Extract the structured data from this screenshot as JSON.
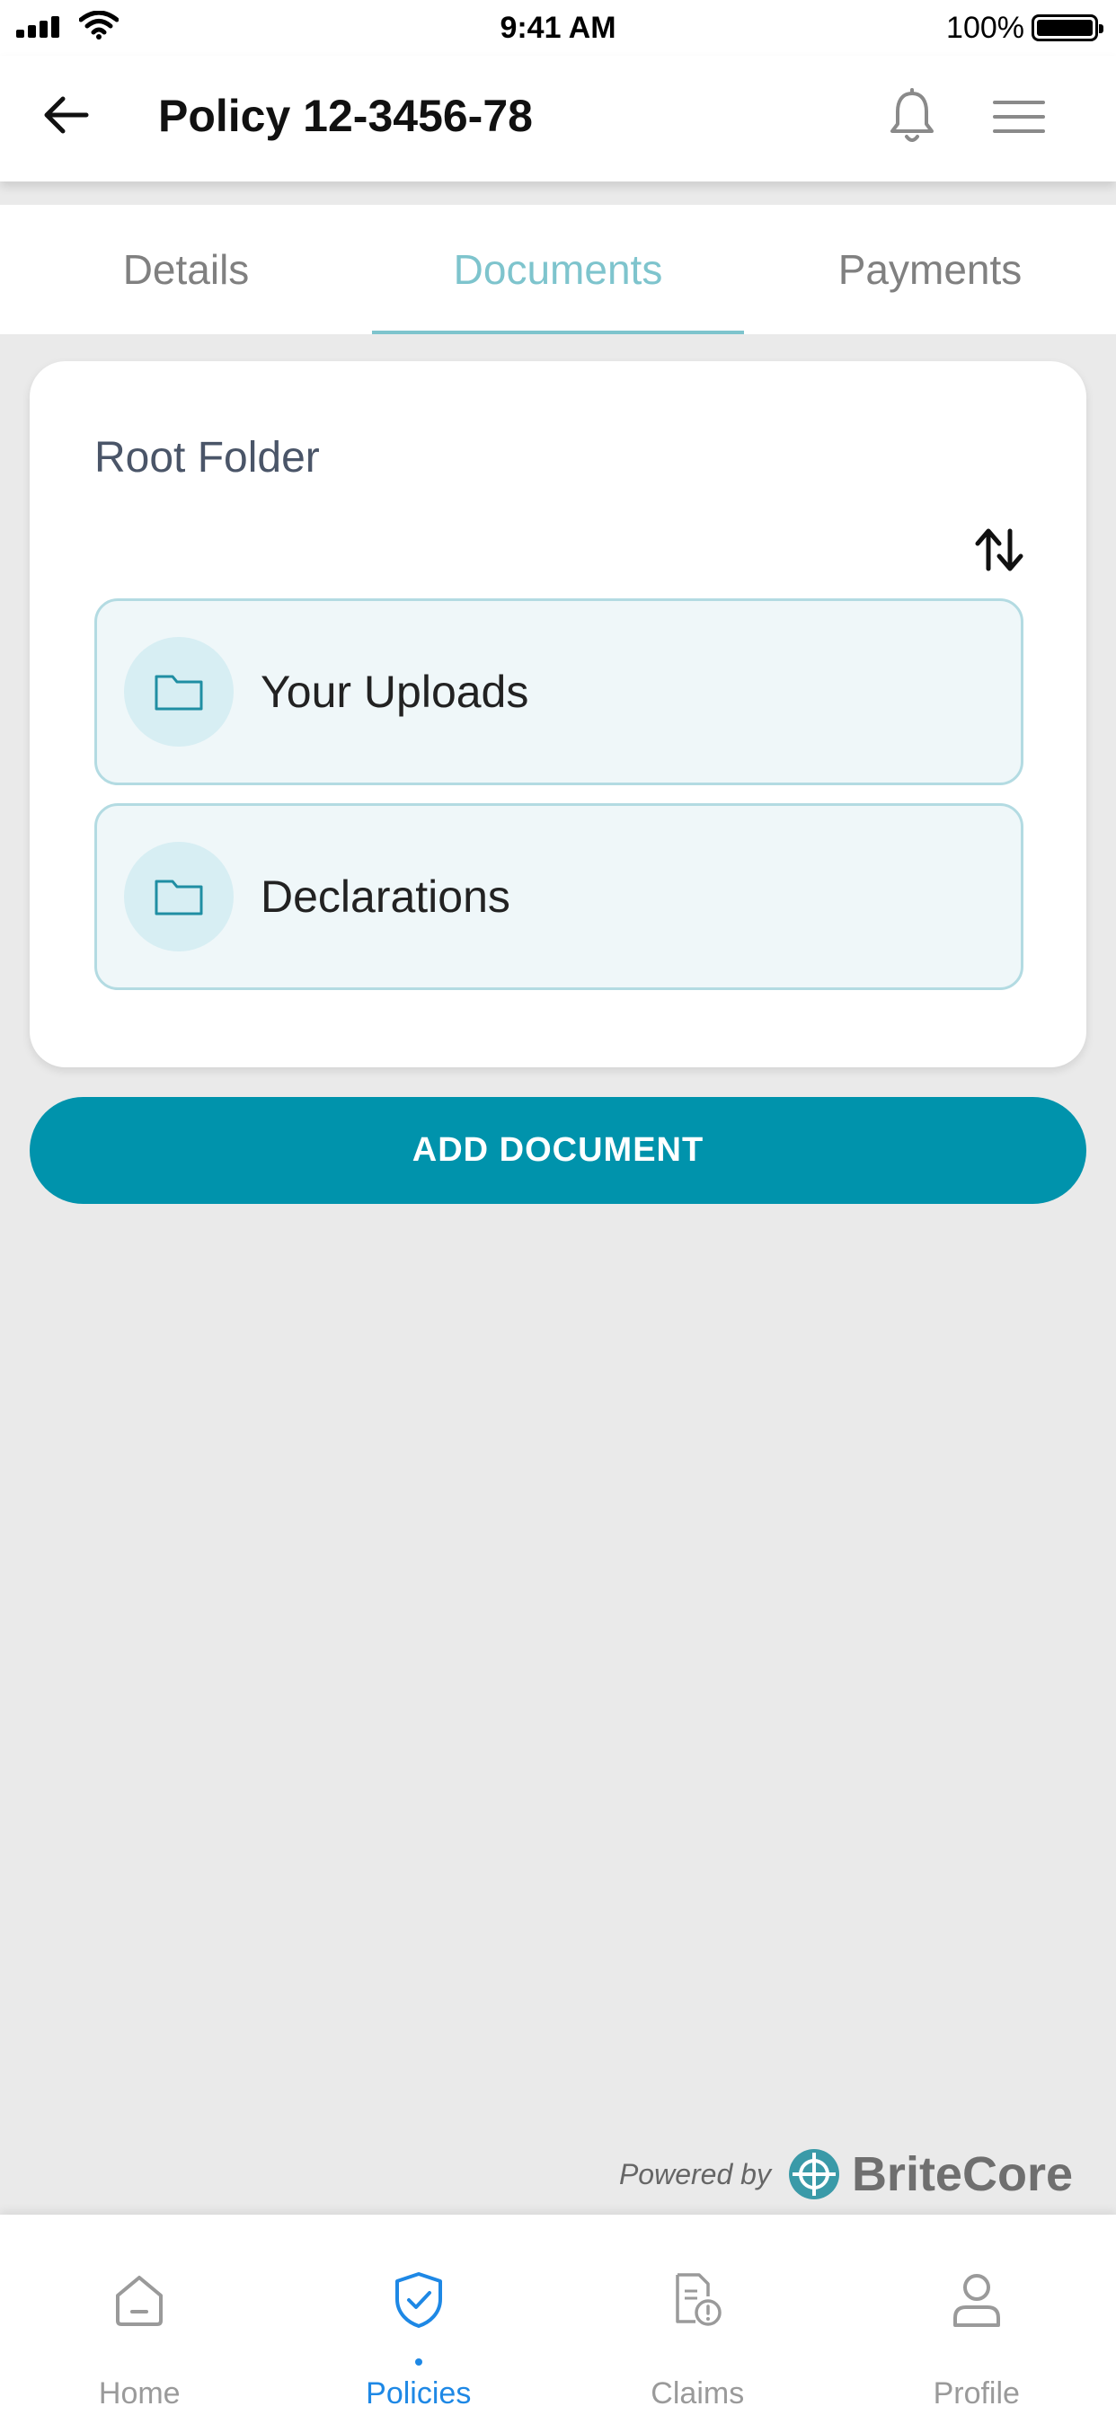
{
  "status_bar": {
    "time": "9:41 AM",
    "battery": "100%"
  },
  "header": {
    "title": "Policy 12-3456-78"
  },
  "tabs": [
    {
      "label": "Details",
      "active": false
    },
    {
      "label": "Documents",
      "active": true
    },
    {
      "label": "Payments",
      "active": false
    }
  ],
  "documents": {
    "folder_title": "Root Folder",
    "folders": [
      {
        "label": "Your Uploads",
        "icon": "folder-icon"
      },
      {
        "label": "Declarations",
        "icon": "folder-icon"
      }
    ],
    "add_button": "ADD DOCUMENT"
  },
  "footer": {
    "powered_by": "Powered by",
    "brand": "BriteCore"
  },
  "bottom_nav": [
    {
      "label": "Home",
      "icon": "home-icon",
      "active": false
    },
    {
      "label": "Policies",
      "icon": "shield-check-icon",
      "active": true
    },
    {
      "label": "Claims",
      "icon": "claim-document-icon",
      "active": false
    },
    {
      "label": "Profile",
      "icon": "person-icon",
      "active": false
    }
  ],
  "colors": {
    "accent": "#0093ac",
    "tab_active": "#7ec4cd",
    "nav_active": "#1e88e5",
    "folder_bg": "#eff7f9",
    "folder_border": "#b3dbe2"
  }
}
